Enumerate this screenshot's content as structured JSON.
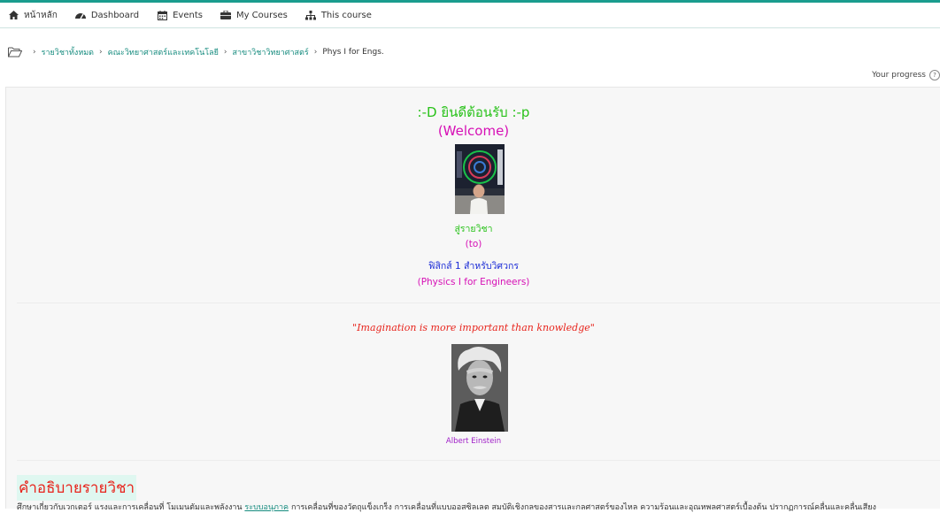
{
  "nav": {
    "items": [
      {
        "label": "หน้าหลัก",
        "icon": "home-icon"
      },
      {
        "label": "Dashboard",
        "icon": "dashboard-icon"
      },
      {
        "label": "Events",
        "icon": "calendar-icon"
      },
      {
        "label": "My Courses",
        "icon": "briefcase-icon"
      },
      {
        "label": "This course",
        "icon": "sitemap-icon"
      }
    ]
  },
  "breadcrumb": {
    "items": [
      {
        "label": "รายวิชาทั้งหมด",
        "link": true
      },
      {
        "label": "คณะวิทยาศาสตร์และเทคโนโลยี",
        "link": true
      },
      {
        "label": "สาขาวิชาวิทยาศาสตร์",
        "link": true
      },
      {
        "label": "Phys I for Engs.",
        "link": false
      }
    ]
  },
  "progress": {
    "label": "Your progress",
    "help": "?"
  },
  "welcome": {
    "thai": ":-D ยินดีต้อนรับ :-p",
    "english": "(Welcome)"
  },
  "course_intro": {
    "to_thai": "สู่รายวิชา",
    "to_english": "(to)",
    "course_thai": "ฟิสิกส์ 1 สำหรับวิศวกร",
    "course_english": "(Physics I for Engineers)"
  },
  "quote": {
    "text": "\"Imagination is more important than knowledge\"",
    "author": "Albert Einstein"
  },
  "description": {
    "title": "คำอธิบายรายวิชา",
    "text_before": "ศึกษาเกี่ยวกับเวกเตอร์ แรงและการเคลื่อนที่ โมเมนตัมและพลังงาน ",
    "link": "ระบบอนุภาค",
    "text_after": " การเคลื่อนที่ของวัตถุแข็งเกร็ง การเคลื่อนที่แบบออสซิลเลต สมบัติเชิงกลของสารและกลศาสตร์ของไหล ความร้อนและอุณหพลศาสตร์เบื้องต้น ปรากฏการณ์คลื่นและคลื่นเสียง"
  },
  "colors": {
    "accent": "#1a9c8e",
    "welcome_green": "#29c21a",
    "magenta": "#d60fb5",
    "blue": "#1a2bd6",
    "quote_red": "#e8241c",
    "author_purple": "#a020c8"
  }
}
